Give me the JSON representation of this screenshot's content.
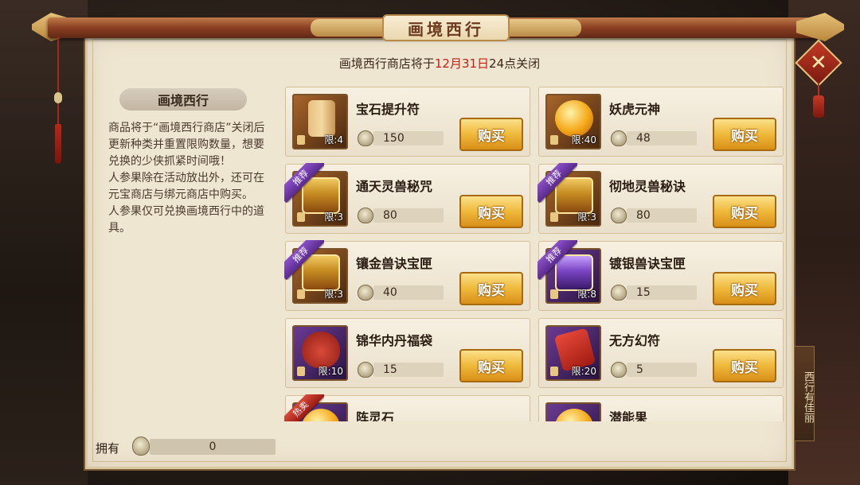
{
  "window": {
    "title": "画境西行",
    "close_icon": "✕"
  },
  "notice": {
    "prefix": "画境西行商店将于",
    "date": "12月31日",
    "suffix": "24点关闭"
  },
  "info": {
    "title": "画境西行",
    "text": "商品将于“画境西行商店”关闭后更新种类并重置限购数量，想要兑换的少侠抓紧时间哦！\n人参果除在活动放出外，还可在元宝商店与绑元商店中购买。\n人参果仅可兑换画境西行中的道具。"
  },
  "side_tab": {
    "label": "西行有佳丽"
  },
  "buy_label": "购买",
  "items": [
    {
      "name": "宝石提升符",
      "price": "150",
      "limit": "限:4",
      "art": "scroll",
      "frame": "brown",
      "ribbon": ""
    },
    {
      "name": "妖虎元神",
      "price": "48",
      "limit": "限:40",
      "art": "orb",
      "frame": "brown",
      "ribbon": ""
    },
    {
      "name": "通天灵兽秘咒",
      "price": "80",
      "limit": "限:3",
      "art": "chest",
      "frame": "brown",
      "ribbon": "推荐"
    },
    {
      "name": "彻地灵兽秘诀",
      "price": "80",
      "limit": "限:3",
      "art": "chest",
      "frame": "brown",
      "ribbon": "推荐"
    },
    {
      "name": "镶金兽诀宝匣",
      "price": "40",
      "limit": "限:3",
      "art": "chest",
      "frame": "brown",
      "ribbon": "推荐"
    },
    {
      "name": "镀银兽诀宝匣",
      "price": "15",
      "limit": "限:8",
      "art": "chest-p",
      "frame": "purple",
      "ribbon": "推荐"
    },
    {
      "name": "锦华内丹福袋",
      "price": "15",
      "limit": "限:10",
      "art": "bag",
      "frame": "purple",
      "ribbon": ""
    },
    {
      "name": "无方幻符",
      "price": "5",
      "limit": "限:20",
      "art": "talisman",
      "frame": "purple",
      "ribbon": ""
    },
    {
      "name": "阵灵石",
      "price": "",
      "limit": "",
      "art": "orb",
      "frame": "purple",
      "ribbon": "热卖"
    },
    {
      "name": "潜能果",
      "price": "",
      "limit": "",
      "art": "orb",
      "frame": "purple",
      "ribbon": ""
    }
  ],
  "owned": {
    "label": "拥有",
    "value": "0"
  }
}
